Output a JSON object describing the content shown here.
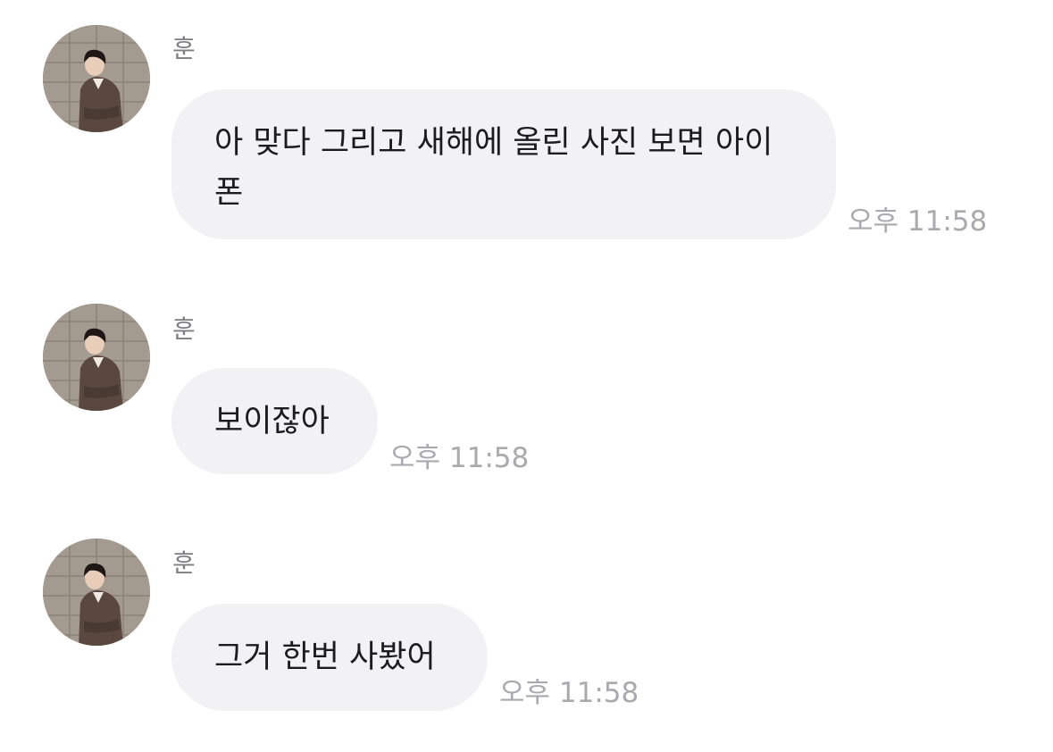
{
  "messages": [
    {
      "sender": "훈",
      "avatar_icon": "profile-photo",
      "text": "아 맞다 그리고 새해에 올린 사진 보면 아이\n폰",
      "time": "오후 11:58"
    },
    {
      "sender": "훈",
      "avatar_icon": "profile-photo",
      "text": "보이잖아",
      "time": "오후 11:58"
    },
    {
      "sender": "훈",
      "avatar_icon": "profile-photo",
      "text": "그거 한번 사봤어",
      "time": "오후 11:58"
    }
  ],
  "colors": {
    "bubble": "#f2f2f5",
    "text": "#1c1c1e",
    "sender": "#7d7d82",
    "time": "#a9a9ae",
    "background": "#ffffff"
  }
}
